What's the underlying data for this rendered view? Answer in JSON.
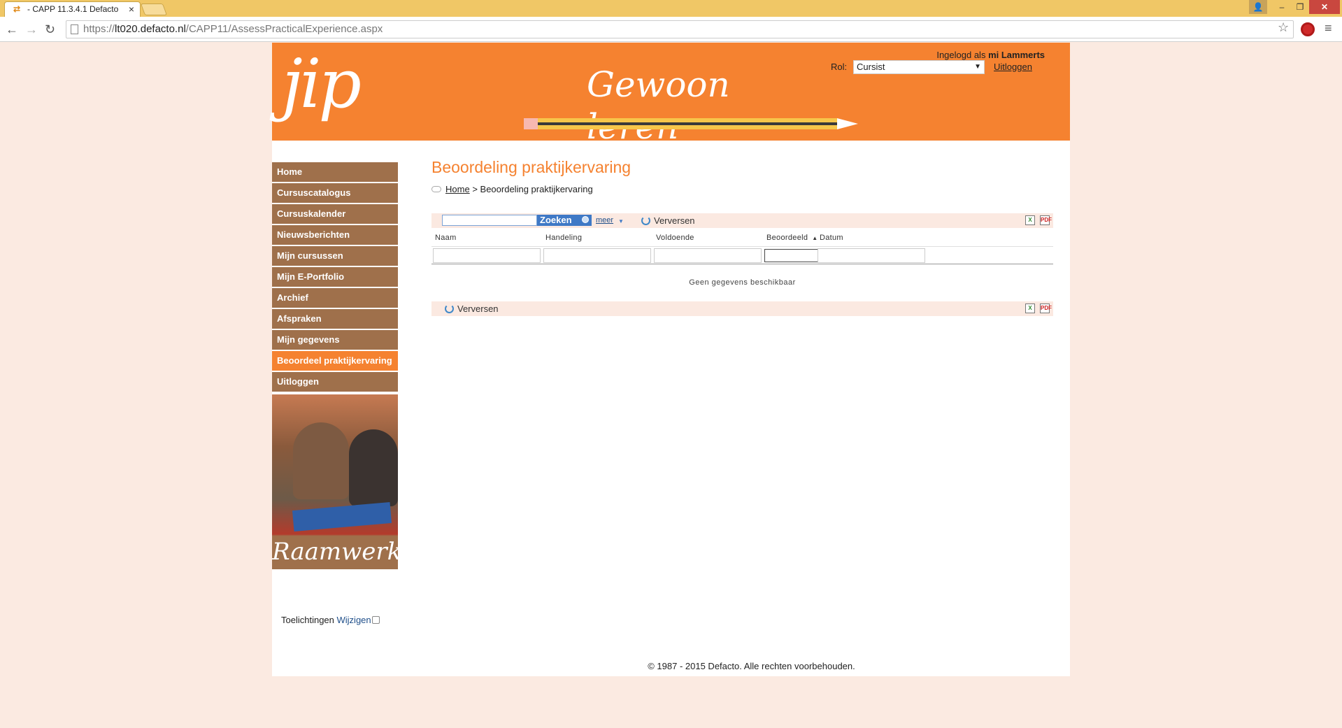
{
  "browser": {
    "tab_title": "- CAPP 11.3.4.1 Defacto",
    "tab_close": "×",
    "url_prefix": "https://",
    "url_host": "lt020.defacto.nl",
    "url_path": "/CAPP11/AssessPracticalExperience.aspx",
    "window_controls": {
      "profile": "👤",
      "minimize": "–",
      "maximize": "❐",
      "close": "✕"
    },
    "nav": {
      "back": "←",
      "forward": "→",
      "reload": "↻",
      "star": "☆",
      "menu": "≡"
    }
  },
  "header": {
    "logo_text": "jip",
    "slogan": "Gewoon leren",
    "login_prefix": "Ingelogd als",
    "login_user": "mi Lammerts",
    "role_label": "Rol:",
    "role_value": "Cursist",
    "logout_link": "Uitloggen"
  },
  "sidebar": {
    "items": [
      {
        "label": "Home",
        "active": false
      },
      {
        "label": "Cursuscatalogus",
        "active": false
      },
      {
        "label": "Cursuskalender",
        "active": false
      },
      {
        "label": "Nieuwsberichten",
        "active": false
      },
      {
        "label": "Mijn cursussen",
        "active": false
      },
      {
        "label": "Mijn E-Portfolio",
        "active": false
      },
      {
        "label": "Archief",
        "active": false
      },
      {
        "label": "Afspraken",
        "active": false
      },
      {
        "label": "Mijn gegevens",
        "active": false
      },
      {
        "label": "Beoordeel praktijkervaring",
        "active": true
      },
      {
        "label": "Uitloggen",
        "active": false
      }
    ],
    "brand_text": "Raamwerk",
    "toelichtingen": "Toelichtingen",
    "wijzigen": "Wijzigen"
  },
  "main": {
    "title": "Beoordeling praktijkervaring",
    "breadcrumb_home": "Home",
    "breadcrumb_sep": ">",
    "breadcrumb_current": "Beoordeling praktijkervaring"
  },
  "grid": {
    "search_placeholder": "",
    "search_button": "Zoeken",
    "more_link": "meer",
    "refresh_label": "Verversen",
    "export_xls": "X",
    "export_pdf": "PDF",
    "columns": [
      "Naam",
      "Handeling",
      "Voldoende",
      "Beoordeeld",
      "Datum"
    ],
    "sort_indicator": "▲",
    "empty_message": "Geen gegevens beschikbaar"
  },
  "footer": {
    "copyright": "© 1987 - 2015 Defacto. Alle rechten voorbehouden."
  },
  "colors": {
    "brand_orange": "#f58230",
    "nav_brown": "#9f704b",
    "page_background": "#fbeae1",
    "search_blue": "#3f79c6"
  }
}
